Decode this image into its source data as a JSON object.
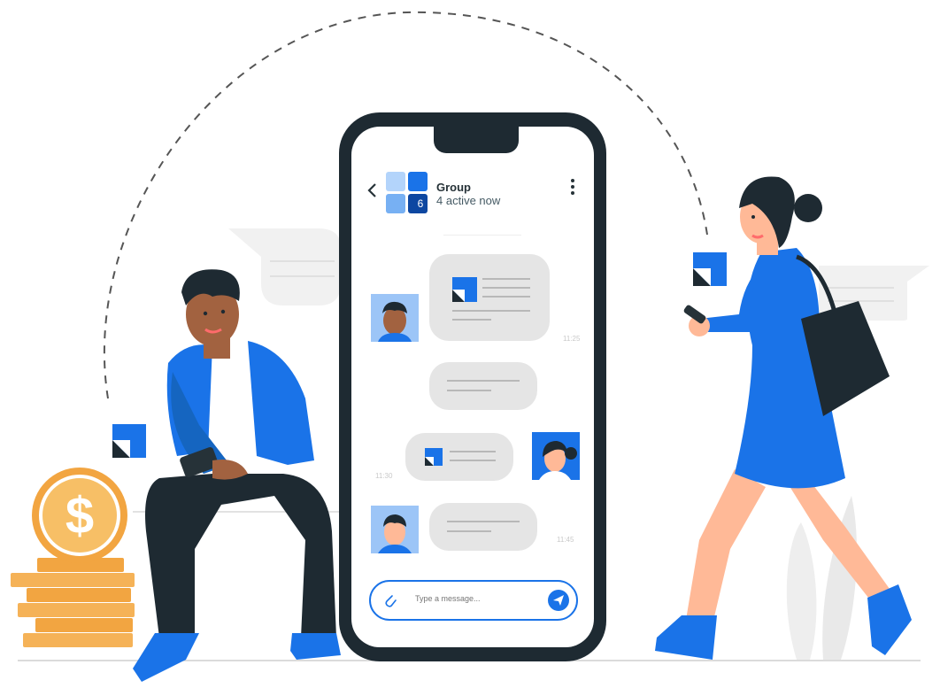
{
  "chat": {
    "title": "Group",
    "subtitle": "4 active now",
    "group_count": "6",
    "messages": [
      {
        "time": "11:25"
      },
      {
        "time": ""
      },
      {
        "time": "11:30"
      },
      {
        "time": "11:45"
      }
    ],
    "input_placeholder": "Type a message..."
  },
  "colors": {
    "accent": "#1a73e8",
    "accent_dark": "#0d47a1",
    "phone_frame": "#263238",
    "bubble": "#e5e5e5",
    "coin": "#f2a541"
  },
  "icons": {
    "back": "chevron-left-icon",
    "menu": "more-vert-icon",
    "attach": "paperclip-icon",
    "send": "send-icon",
    "dollar": "dollar-coin-icon",
    "logo": "folded-square-logo-icon"
  }
}
